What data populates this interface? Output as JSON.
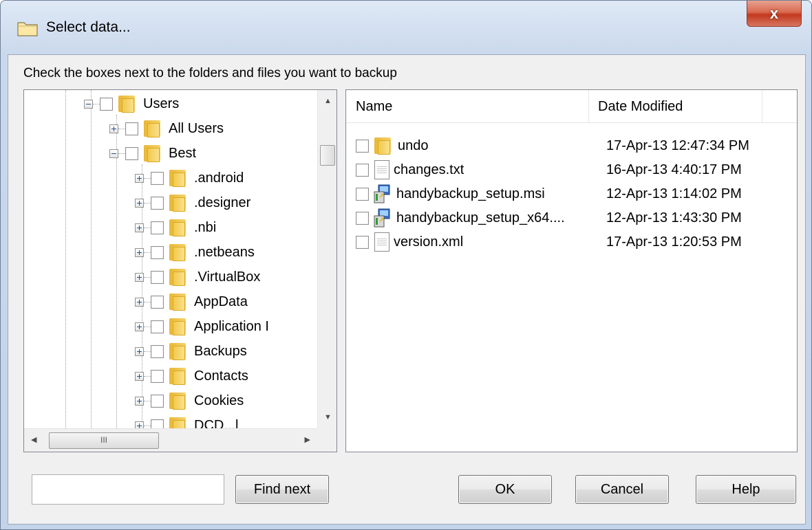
{
  "window": {
    "title": "Select data...",
    "close_label": "x"
  },
  "instruction": "Check the boxes next to the folders and files you want to backup",
  "tree": {
    "items": [
      {
        "label": "Users",
        "level": 0,
        "expander": "minus"
      },
      {
        "label": "All Users",
        "level": 1,
        "expander": "plus"
      },
      {
        "label": "Best",
        "level": 1,
        "expander": "minus"
      },
      {
        "label": ".android",
        "level": 2,
        "expander": "plus"
      },
      {
        "label": ".designer",
        "level": 2,
        "expander": "plus"
      },
      {
        "label": ".nbi",
        "level": 2,
        "expander": "plus"
      },
      {
        "label": ".netbeans",
        "level": 2,
        "expander": "plus"
      },
      {
        "label": ".VirtualBox",
        "level": 2,
        "expander": "plus"
      },
      {
        "label": "AppData",
        "level": 2,
        "expander": "plus"
      },
      {
        "label": "Application I",
        "level": 2,
        "expander": "plus"
      },
      {
        "label": "Backups",
        "level": 2,
        "expander": "plus"
      },
      {
        "label": "Contacts",
        "level": 2,
        "expander": "plus"
      },
      {
        "label": "Cookies",
        "level": 2,
        "expander": "plus"
      },
      {
        "label": "DCD...l",
        "level": 2,
        "expander": "plus"
      }
    ],
    "hscroll_grip": "III"
  },
  "list": {
    "columns": {
      "name": "Name",
      "date": "Date Modified"
    },
    "files": [
      {
        "name": "undo",
        "date": "17-Apr-13 12:47:34 PM",
        "icon": "folder-icon"
      },
      {
        "name": "changes.txt",
        "date": "16-Apr-13 4:40:17 PM",
        "icon": "text-file-icon"
      },
      {
        "name": "handybackup_setup.msi",
        "date": "12-Apr-13 1:14:02 PM",
        "icon": "installer-icon"
      },
      {
        "name": "handybackup_setup_x64....",
        "date": "12-Apr-13 1:43:30 PM",
        "icon": "installer-icon"
      },
      {
        "name": "version.xml",
        "date": "17-Apr-13 1:20:53 PM",
        "icon": "text-file-icon"
      }
    ]
  },
  "find": {
    "value": "",
    "button": "Find next"
  },
  "buttons": {
    "ok": "OK",
    "cancel": "Cancel",
    "help": "Help"
  }
}
